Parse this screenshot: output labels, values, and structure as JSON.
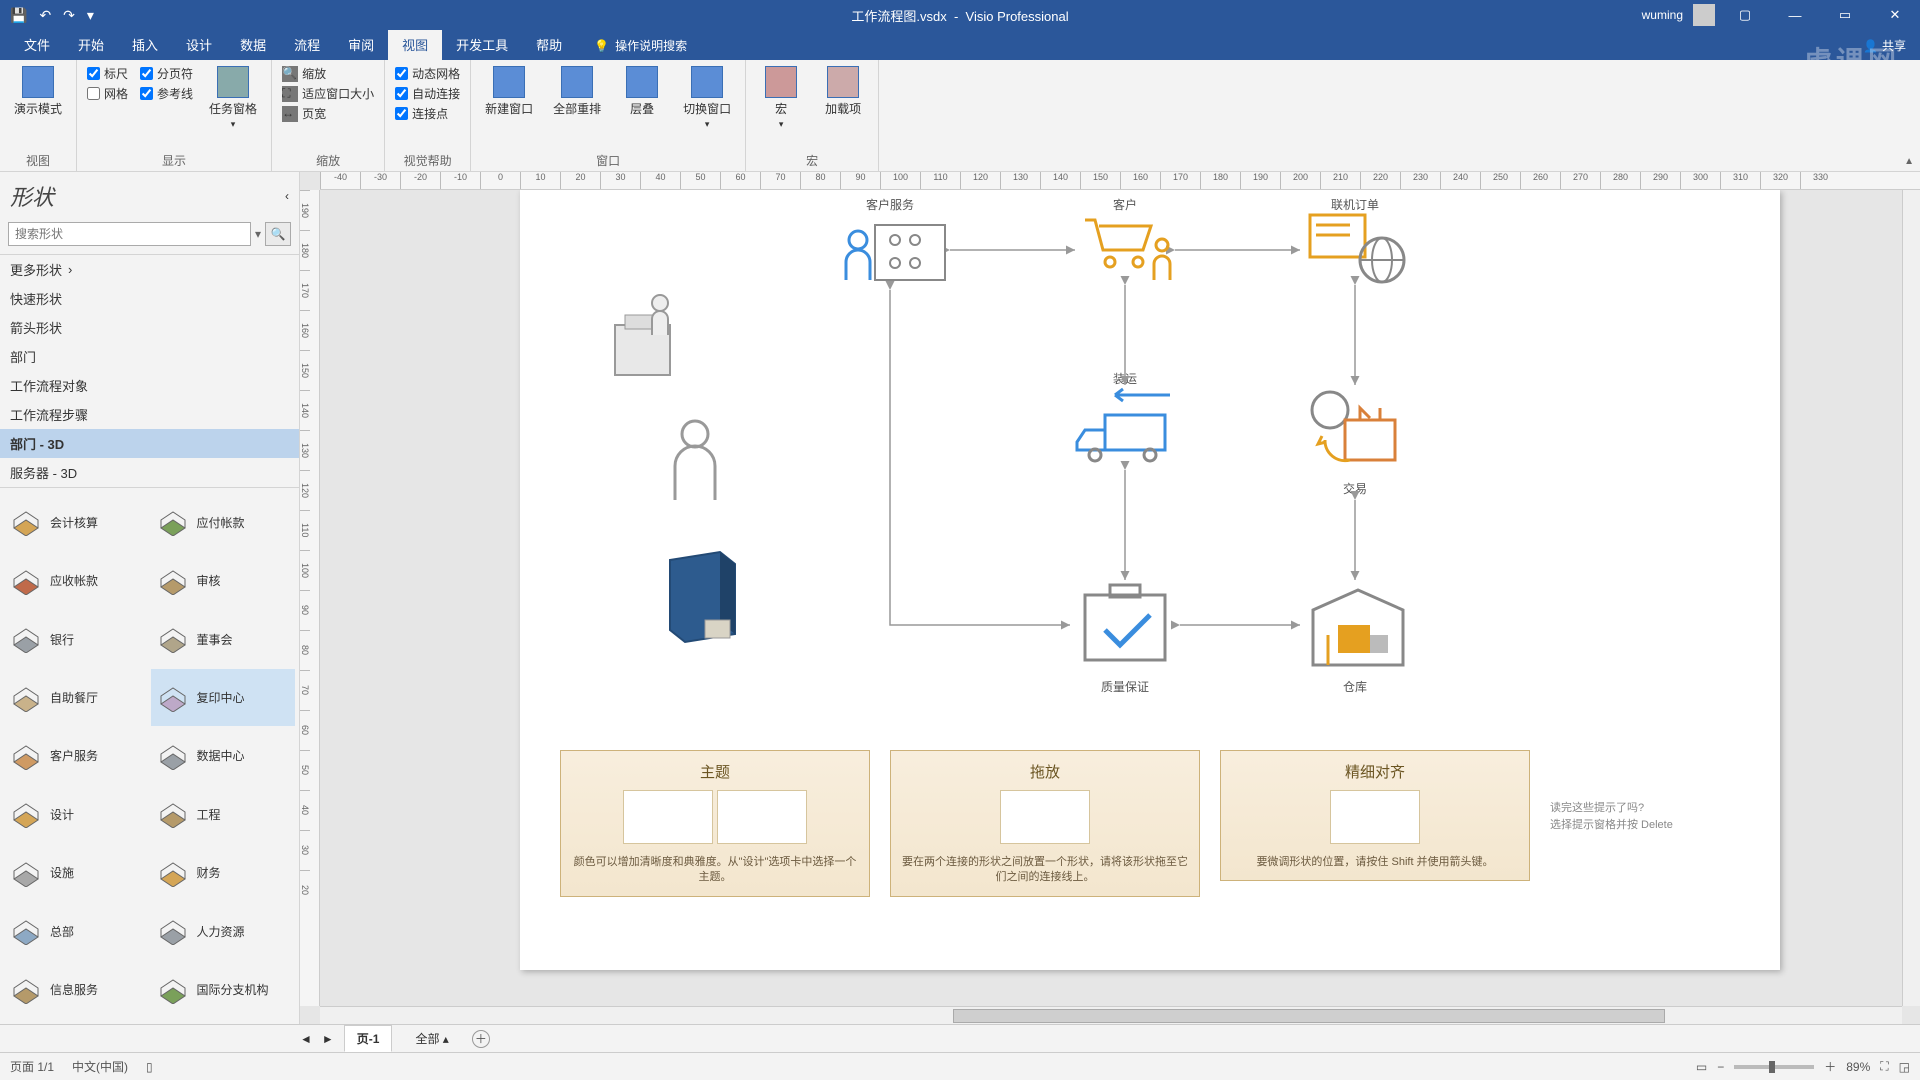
{
  "title": {
    "filename": "工作流程图.vsdx",
    "app": "Visio Professional"
  },
  "user": "wuming",
  "share": "共享",
  "watermark": "虎课网",
  "qat": {
    "save": "💾",
    "undo": "↶",
    "redo": "↷"
  },
  "tabs": [
    "文件",
    "开始",
    "插入",
    "设计",
    "数据",
    "流程",
    "审阅",
    "视图",
    "开发工具",
    "帮助"
  ],
  "active_tab": 7,
  "tell_me": "操作说明搜索",
  "ribbon": {
    "view": {
      "group": "视图",
      "presentation": "演示模式"
    },
    "show": {
      "group": "显示",
      "ruler": "标尺",
      "pagebreaks": "分页符",
      "grid": "网格",
      "guides": "参考线",
      "taskpanes": "任务窗格",
      "ruler_ck": true,
      "pagebreaks_ck": true,
      "grid_ck": false,
      "guides_ck": true
    },
    "zoom": {
      "group": "缩放",
      "zoom": "缩放",
      "fit": "适应窗口大小",
      "pagewidth": "页宽"
    },
    "visual": {
      "group": "视觉帮助",
      "dyngrid": "动态网格",
      "autolink": "自动连接",
      "connpts": "连接点",
      "dg_ck": true,
      "al_ck": true,
      "cp_ck": true
    },
    "window": {
      "group": "窗口",
      "newwin": "新建窗口",
      "arrange": "全部重排",
      "cascade": "层叠",
      "switch": "切换窗口"
    },
    "macro": {
      "group": "宏",
      "macros": "宏",
      "addins": "加载项"
    }
  },
  "shapes": {
    "title": "形状",
    "search_ph": "搜索形状",
    "more": "更多形状",
    "stencils": [
      "快速形状",
      "箭头形状",
      "部门",
      "工作流程对象",
      "工作流程步骤",
      "部门 - 3D",
      "服务器 - 3D"
    ],
    "selected": "部门 - 3D",
    "items": [
      {
        "n": "会计核算",
        "c": "#d4a556"
      },
      {
        "n": "应付帐款",
        "c": "#7aa05a"
      },
      {
        "n": "应收帐款",
        "c": "#c06a4a"
      },
      {
        "n": "审核",
        "c": "#b59a6a"
      },
      {
        "n": "银行",
        "c": "#9aa0a6"
      },
      {
        "n": "董事会",
        "c": "#b0a58a"
      },
      {
        "n": "自助餐厅",
        "c": "#c9b28a"
      },
      {
        "n": "复印中心",
        "c": "#bda9c8"
      },
      {
        "n": "客户服务",
        "c": "#cf9a63"
      },
      {
        "n": "数据中心",
        "c": "#9aa0a6"
      },
      {
        "n": "设计",
        "c": "#d4a556"
      },
      {
        "n": "工程",
        "c": "#b59a6a"
      },
      {
        "n": "设施",
        "c": "#a8a8a8"
      },
      {
        "n": "财务",
        "c": "#d4a556"
      },
      {
        "n": "总部",
        "c": "#8da9c4"
      },
      {
        "n": "人力资源",
        "c": "#9aa0a6"
      },
      {
        "n": "信息服务",
        "c": "#b59a6a"
      },
      {
        "n": "国际分支机构",
        "c": "#7aa05a"
      }
    ],
    "hover": "复印中心"
  },
  "ruler_h": [
    -40,
    -30,
    -20,
    -10,
    0,
    10,
    20,
    30,
    40,
    50,
    60,
    70,
    80,
    90,
    100,
    110,
    120,
    130,
    140,
    150,
    160,
    170,
    180,
    190,
    200,
    210,
    220,
    230,
    240,
    250,
    260,
    270,
    280,
    290,
    300,
    310,
    320,
    330
  ],
  "ruler_v": [
    190,
    180,
    170,
    160,
    150,
    140,
    130,
    120,
    110,
    100,
    90,
    80,
    70,
    60,
    50,
    40,
    30,
    20
  ],
  "diagram": {
    "labels": {
      "cust_service": "客户服务",
      "customer": "客户",
      "online_order": "联机订单",
      "shipping": "装运",
      "transaction": "交易",
      "qa": "质量保证",
      "warehouse": "仓库"
    }
  },
  "tips": [
    {
      "t": "主题",
      "d": "颜色可以增加清晰度和典雅度。从\"设计\"选项卡中选择一个主题。"
    },
    {
      "t": "拖放",
      "d": "要在两个连接的形状之间放置一个形状，请将该形状拖至它们之间的连接线上。"
    },
    {
      "t": "精细对齐",
      "d": "要微调形状的位置，请按住 Shift 并使用箭头键。"
    }
  ],
  "tip_aside": {
    "l1": "读完这些提示了吗?",
    "l2": "选择提示窗格并按 Delete"
  },
  "sheet": {
    "page1": "页-1",
    "all": "全部"
  },
  "status": {
    "page": "页面 1/1",
    "lang": "中文(中国)",
    "zoom": "89%"
  }
}
